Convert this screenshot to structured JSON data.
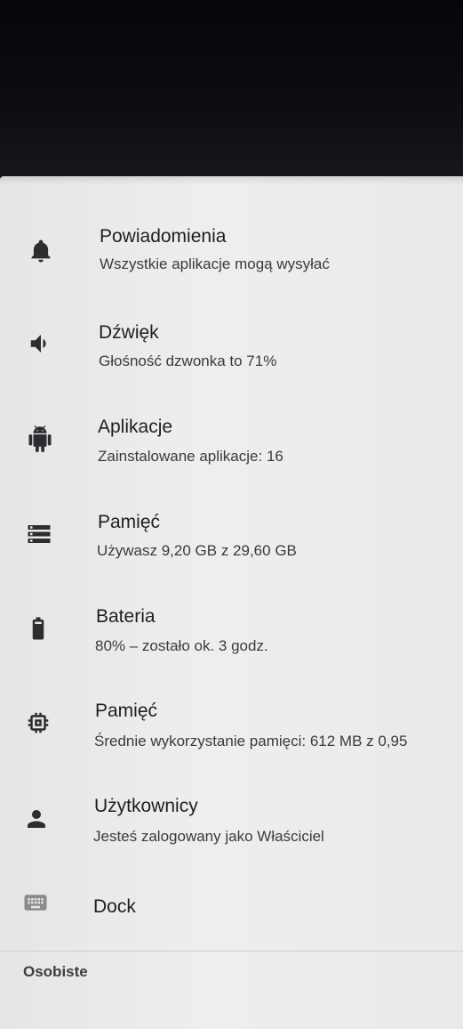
{
  "settings": {
    "items": [
      {
        "id": "notifications",
        "icon": "bell-icon",
        "title": "Powiadomienia",
        "subtitle": "Wszystkie aplikacje mogą wysyłać"
      },
      {
        "id": "sound",
        "icon": "volume-icon",
        "title": "Dźwięk",
        "subtitle": "Głośność dzwonka to 71%"
      },
      {
        "id": "apps",
        "icon": "android-icon",
        "title": "Aplikacje",
        "subtitle": "Zainstalowane aplikacje: 16"
      },
      {
        "id": "storage",
        "icon": "storage-icon",
        "title": "Pamięć",
        "subtitle": "Używasz 9,20 GB z 29,60 GB"
      },
      {
        "id": "battery",
        "icon": "battery-icon",
        "title": "Bateria",
        "subtitle": "80% – zostało ok. 3 godz."
      },
      {
        "id": "memory",
        "icon": "memory-chip-icon",
        "title": "Pamięć",
        "subtitle": "Średnie wykorzystanie pamięci: 612 MB z 0,95"
      },
      {
        "id": "users",
        "icon": "person-icon",
        "title": "Użytkownicy",
        "subtitle": "Jesteś zalogowany jako Właściciel"
      },
      {
        "id": "dock",
        "icon": "keyboard-icon",
        "title": "Dock"
      }
    ],
    "section_header": "Osobiste"
  },
  "colors": {
    "screen_background": "#eeeeec",
    "icon": "#2c2d30",
    "title_text": "#1e1f22",
    "subtitle_text": "#3a3b3e"
  }
}
